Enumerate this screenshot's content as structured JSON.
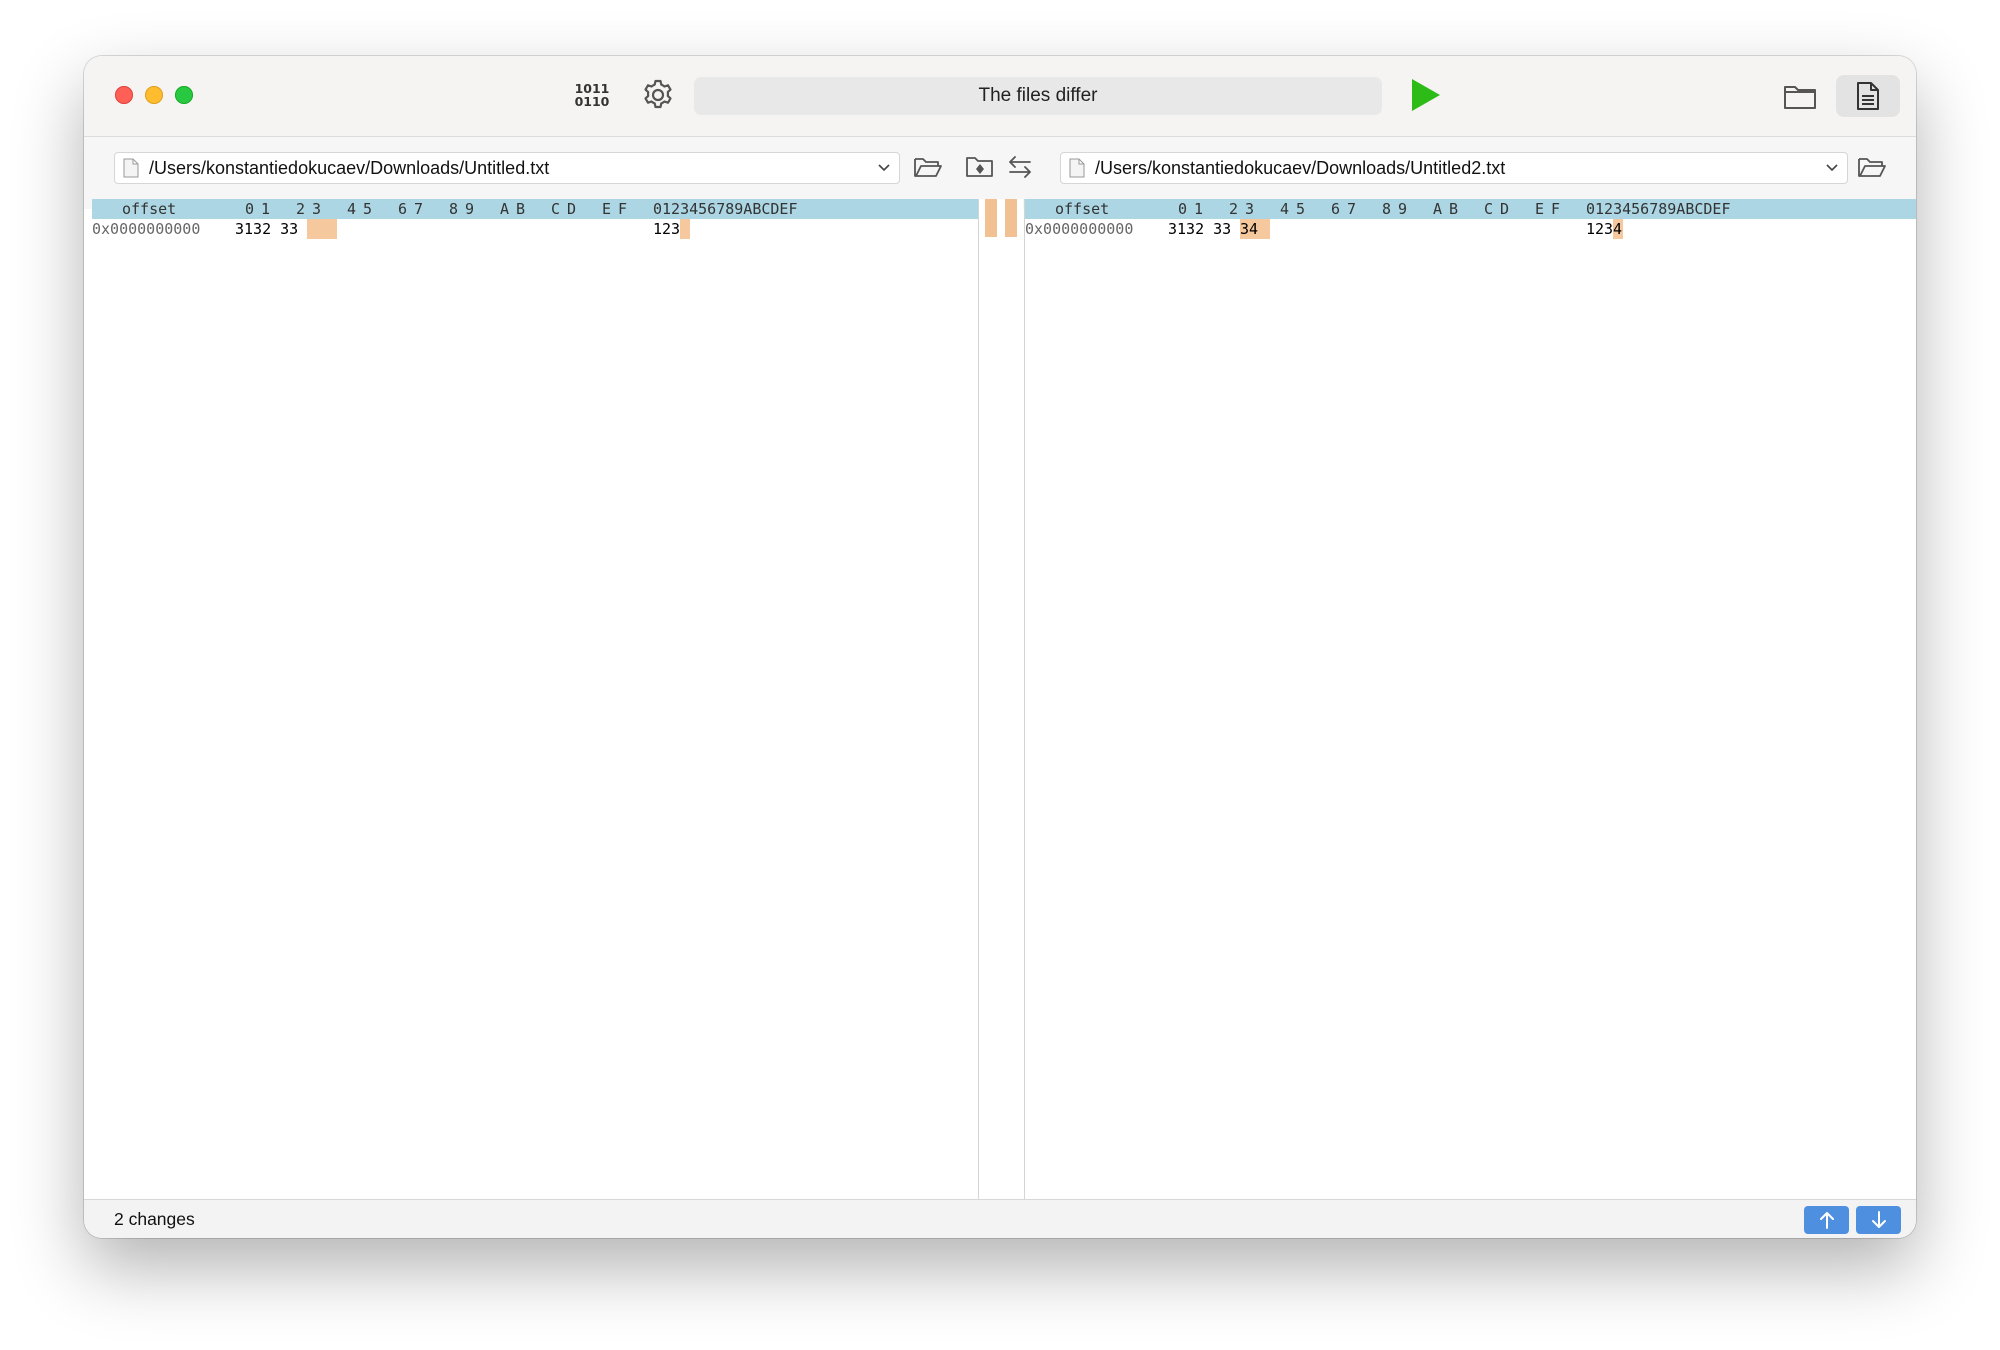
{
  "toolbar": {
    "binary_icon_text_top": "1011",
    "binary_icon_text_bottom": "0110",
    "status": "The files differ",
    "run_color": "#2dbb18"
  },
  "left": {
    "path": "/Users/konstantiedokucaev/Downloads/Untitled.txt"
  },
  "right": {
    "path": "/Users/konstantiedokucaev/Downloads/Untitled2.txt"
  },
  "hex": {
    "header_offset": "offset",
    "header_columns": [
      "0",
      "1",
      "2",
      "3",
      "4",
      "5",
      "6",
      "7",
      "8",
      "9",
      "A",
      "B",
      "C",
      "D",
      "E",
      "F"
    ],
    "header_ascii": "0123456789ABCDEF",
    "left_row": {
      "offset": "0x0000000000",
      "bytes_plain": "3132 33",
      "bytes_diff": "",
      "ascii_plain": "123",
      "ascii_diff": ""
    },
    "right_row": {
      "offset": "0x0000000000",
      "bytes_plain": "3132 33",
      "bytes_diff": "34",
      "ascii_plain": "123",
      "ascii_diff": "4"
    }
  },
  "footer": {
    "changes": "2 changes"
  },
  "icons": [
    "binary-icon",
    "gear-icon",
    "run-icon",
    "folder-icon",
    "document-icon",
    "open-folder-icon",
    "chevron-down-icon",
    "folder-compare-icon",
    "swap-icon",
    "arrow-up-icon",
    "arrow-down-icon"
  ],
  "colors": {
    "header_bg": "#acd6e3",
    "diff_highlight": "#f6c89d",
    "nav_button": "#4f8fe0"
  }
}
